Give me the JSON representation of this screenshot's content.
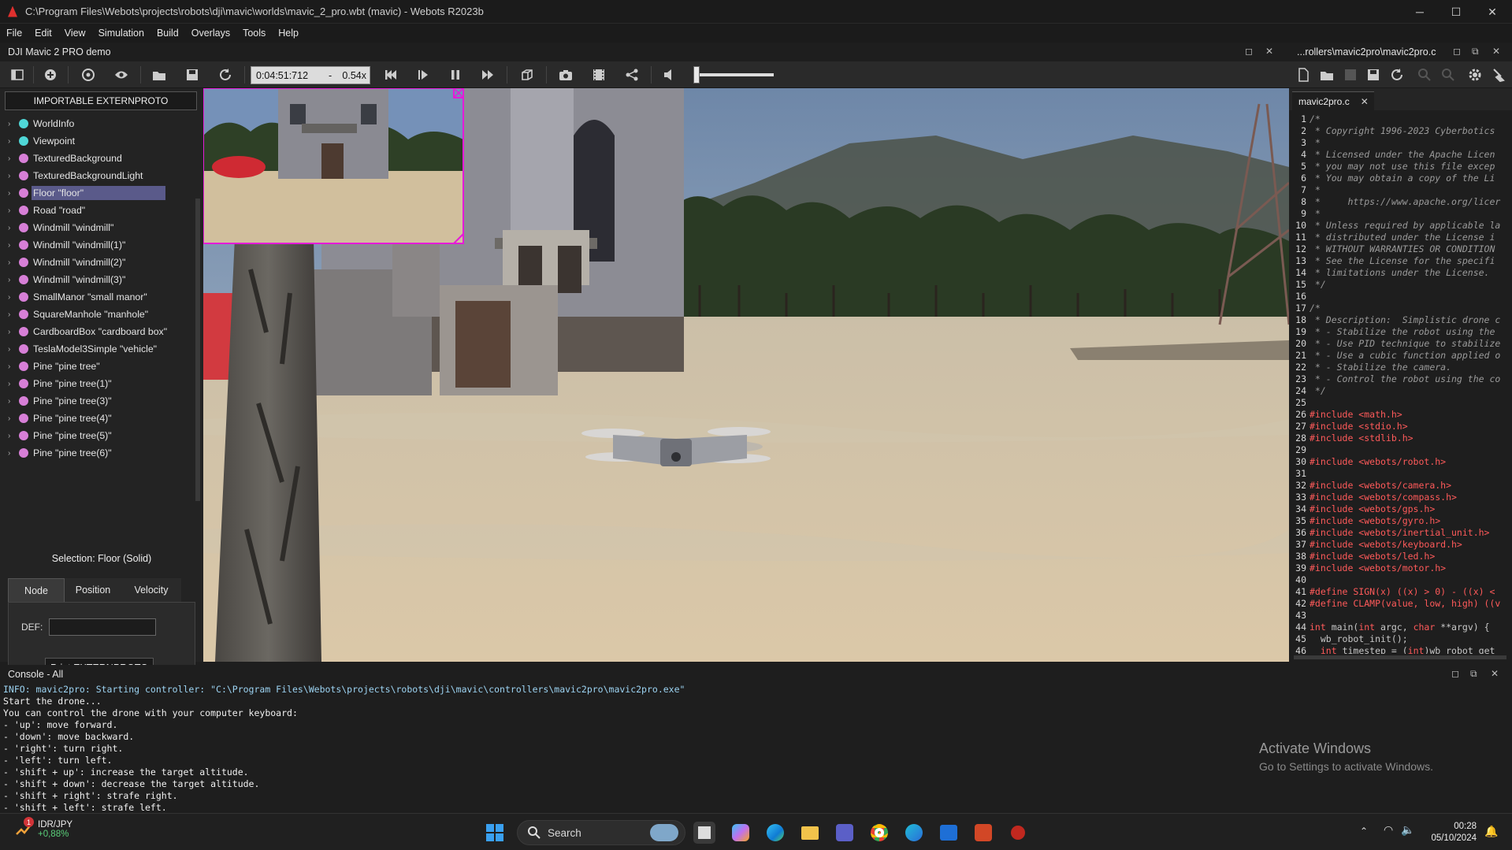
{
  "window": {
    "title": "C:\\Program Files\\Webots\\projects\\robots\\dji\\mavic\\worlds\\mavic_2_pro.wbt (mavic) - Webots R2023b",
    "minimize": "─",
    "maximize": "☐",
    "close": "✕"
  },
  "menu": [
    "File",
    "Edit",
    "View",
    "Simulation",
    "Build",
    "Overlays",
    "Tools",
    "Help"
  ],
  "view3d": {
    "title": "DJI Mavic 2 PRO demo"
  },
  "editor_header": {
    "title": "...rollers\\mavic2pro\\mavic2pro.c"
  },
  "toolbar": {
    "time": "0:04:51:712",
    "dash": "-",
    "speed": "0.54x",
    "volume_level": 0.0
  },
  "scene_tree": {
    "import_button": "IMPORTABLE EXTERNPROTO",
    "items": [
      {
        "label": "WorldInfo",
        "dot": "#4fd7d7"
      },
      {
        "label": "Viewpoint",
        "dot": "#4fd7d7"
      },
      {
        "label": "TexturedBackground",
        "dot": "#d77fd7"
      },
      {
        "label": "TexturedBackgroundLight",
        "dot": "#d77fd7"
      },
      {
        "label": "Floor \"floor\"",
        "dot": "#d77fd7",
        "selected": true
      },
      {
        "label": "Road \"road\"",
        "dot": "#d77fd7"
      },
      {
        "label": "Windmill \"windmill\"",
        "dot": "#d77fd7"
      },
      {
        "label": "Windmill \"windmill(1)\"",
        "dot": "#d77fd7"
      },
      {
        "label": "Windmill \"windmill(2)\"",
        "dot": "#d77fd7"
      },
      {
        "label": "Windmill \"windmill(3)\"",
        "dot": "#d77fd7"
      },
      {
        "label": "SmallManor \"small manor\"",
        "dot": "#d77fd7"
      },
      {
        "label": "SquareManhole \"manhole\"",
        "dot": "#d77fd7"
      },
      {
        "label": "CardboardBox \"cardboard box\"",
        "dot": "#d77fd7"
      },
      {
        "label": "TeslaModel3Simple \"vehicle\"",
        "dot": "#d77fd7"
      },
      {
        "label": "Pine \"pine tree\"",
        "dot": "#d77fd7"
      },
      {
        "label": "Pine \"pine tree(1)\"",
        "dot": "#d77fd7"
      },
      {
        "label": "Pine \"pine tree(3)\"",
        "dot": "#d77fd7"
      },
      {
        "label": "Pine \"pine tree(4)\"",
        "dot": "#d77fd7"
      },
      {
        "label": "Pine \"pine tree(5)\"",
        "dot": "#d77fd7"
      },
      {
        "label": "Pine \"pine tree(6)\"",
        "dot": "#d77fd7"
      }
    ]
  },
  "field_editor": {
    "selection": "Selection: Floor (Solid)",
    "tabs": [
      "Node",
      "Position",
      "Velocity"
    ],
    "def_label": "DEF:",
    "def_value": "",
    "print_button": "Print EXTERNPROTO"
  },
  "editor": {
    "tab": "mavic2pro.c",
    "lines": [
      {
        "n": "1",
        "t": "/*",
        "k": "cm"
      },
      {
        "n": "2",
        "t": " * Copyright 1996-2023 Cyberbotics",
        "k": "cm"
      },
      {
        "n": "3",
        "t": " *",
        "k": "cm"
      },
      {
        "n": "4",
        "t": " * Licensed under the Apache Licen",
        "k": "cm"
      },
      {
        "n": "5",
        "t": " * you may not use this file excep",
        "k": "cm"
      },
      {
        "n": "6",
        "t": " * You may obtain a copy of the Li",
        "k": "cm"
      },
      {
        "n": "7",
        "t": " *",
        "k": "cm"
      },
      {
        "n": "8",
        "t": " *     https://www.apache.org/licer",
        "k": "cm"
      },
      {
        "n": "9",
        "t": " *",
        "k": "cm"
      },
      {
        "n": "10",
        "t": " * Unless required by applicable la",
        "k": "cm"
      },
      {
        "n": "11",
        "t": " * distributed under the License i",
        "k": "cm"
      },
      {
        "n": "12",
        "t": " * WITHOUT WARRANTIES OR CONDITION",
        "k": "cm"
      },
      {
        "n": "13",
        "t": " * See the License for the specifi",
        "k": "cm"
      },
      {
        "n": "14",
        "t": " * limitations under the License.",
        "k": "cm"
      },
      {
        "n": "15",
        "t": " */",
        "k": "cm"
      },
      {
        "n": "16",
        "t": "",
        "k": "cm"
      },
      {
        "n": "17",
        "t": "/*",
        "k": "cm"
      },
      {
        "n": "18",
        "t": " * Description:  Simplistic drone c",
        "k": "cm"
      },
      {
        "n": "19",
        "t": " * - Stabilize the robot using the",
        "k": "cm"
      },
      {
        "n": "20",
        "t": " * - Use PID technique to stabilize",
        "k": "cm"
      },
      {
        "n": "21",
        "t": " * - Use a cubic function applied o",
        "k": "cm"
      },
      {
        "n": "22",
        "t": " * - Stabilize the camera.",
        "k": "cm"
      },
      {
        "n": "23",
        "t": " * - Control the robot using the co",
        "k": "cm"
      },
      {
        "n": "24",
        "t": " */",
        "k": "cm"
      },
      {
        "n": "25",
        "t": "",
        "k": "cm"
      },
      {
        "n": "26",
        "t": "#include <math.h>",
        "k": "pp"
      },
      {
        "n": "27",
        "t": "#include <stdio.h>",
        "k": "pp"
      },
      {
        "n": "28",
        "t": "#include <stdlib.h>",
        "k": "pp"
      },
      {
        "n": "29",
        "t": "",
        "k": "pp"
      },
      {
        "n": "30",
        "t": "#include <webots/robot.h>",
        "k": "pp"
      },
      {
        "n": "31",
        "t": "",
        "k": "pp"
      },
      {
        "n": "32",
        "t": "#include <webots/camera.h>",
        "k": "pp"
      },
      {
        "n": "33",
        "t": "#include <webots/compass.h>",
        "k": "pp"
      },
      {
        "n": "34",
        "t": "#include <webots/gps.h>",
        "k": "pp"
      },
      {
        "n": "35",
        "t": "#include <webots/gyro.h>",
        "k": "pp"
      },
      {
        "n": "36",
        "t": "#include <webots/inertial_unit.h>",
        "k": "pp"
      },
      {
        "n": "37",
        "t": "#include <webots/keyboard.h>",
        "k": "pp"
      },
      {
        "n": "38",
        "t": "#include <webots/led.h>",
        "k": "pp"
      },
      {
        "n": "39",
        "t": "#include <webots/motor.h>",
        "k": "pp"
      },
      {
        "n": "40",
        "t": "",
        "k": "pp"
      },
      {
        "n": "41",
        "t": "#define SIGN(x) ((x) > 0) - ((x) <",
        "k": "pp"
      },
      {
        "n": "42",
        "t": "#define CLAMP(value, low, high) ((v",
        "k": "pp"
      },
      {
        "n": "43",
        "t": "",
        "k": "code"
      },
      {
        "n": "44",
        "t": "int main(int argc, char **argv) {",
        "k": "code"
      },
      {
        "n": "45",
        "t": "  wb_robot_init();",
        "k": "code"
      },
      {
        "n": "46",
        "t": "  int timestep = (int)wb_robot_get",
        "k": "code"
      }
    ]
  },
  "console": {
    "title": "Console - All",
    "lines": [
      {
        "t": "INFO: mavic2pro: Starting controller: \"C:\\Program Files\\Webots\\projects\\robots\\dji\\mavic\\controllers\\mavic2pro\\mavic2pro.exe\"",
        "info": true
      },
      {
        "t": "Start the drone...",
        "info": false
      },
      {
        "t": "You can control the drone with your computer keyboard:",
        "info": false
      },
      {
        "t": "- 'up': move forward.",
        "info": false
      },
      {
        "t": "- 'down': move backward.",
        "info": false
      },
      {
        "t": "- 'right': turn right.",
        "info": false
      },
      {
        "t": "- 'left': turn left.",
        "info": false
      },
      {
        "t": "- 'shift + up': increase the target altitude.",
        "info": false
      },
      {
        "t": "- 'shift + down': decrease the target altitude.",
        "info": false
      },
      {
        "t": "- 'shift + right': strafe right.",
        "info": false
      },
      {
        "t": "- 'shift + left': strafe left.",
        "info": false
      }
    ],
    "watermark_title": "Activate Windows",
    "watermark_sub": "Go to Settings to activate Windows."
  },
  "taskbar": {
    "ticker": "IDR/JPY",
    "ticker_change": "+0,88%",
    "ticker_badge": "1",
    "search_placeholder": "Search",
    "time": "00:28",
    "date": "05/10/2024"
  }
}
